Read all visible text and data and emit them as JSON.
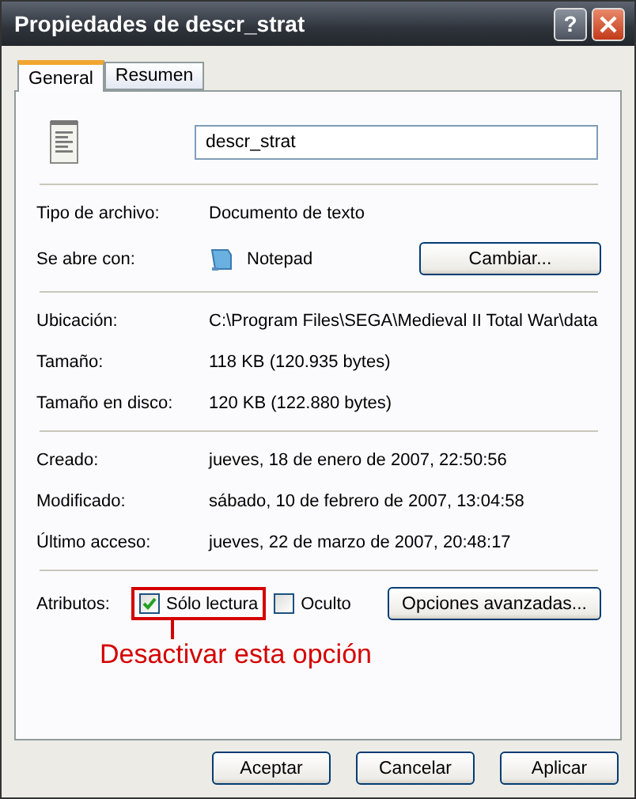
{
  "window": {
    "title": "Propiedades de descr_strat",
    "help_button": "?"
  },
  "tabs": [
    {
      "label": "General",
      "selected": true
    },
    {
      "label": "Resumen",
      "selected": false
    }
  ],
  "file": {
    "name": "descr_strat"
  },
  "sections": [
    {
      "rows": [
        {
          "label": "Tipo de archivo:",
          "value": "Documento de texto"
        },
        {
          "label": "Se abre con:",
          "value": "Notepad",
          "icon": true,
          "button": "Cambiar..."
        }
      ]
    },
    {
      "rows": [
        {
          "label": "Ubicación:",
          "value": "C:\\Program Files\\SEGA\\Medieval II Total War\\data"
        },
        {
          "label": "Tamaño:",
          "value": "118 KB (120.935 bytes)"
        },
        {
          "label": "Tamaño en disco:",
          "value": "120 KB (122.880 bytes)"
        }
      ]
    },
    {
      "rows": [
        {
          "label": "Creado:",
          "value": "jueves, 18 de enero de 2007, 22:50:56"
        },
        {
          "label": "Modificado:",
          "value": "sábado, 10 de febrero de 2007, 13:04:58"
        },
        {
          "label": "Último acceso:",
          "value": "jueves, 22 de marzo de 2007, 20:48:17"
        }
      ]
    }
  ],
  "attributes": {
    "label": "Atributos:",
    "checkboxes": [
      {
        "label": "Sólo lectura",
        "checked": true,
        "highlighted": true
      },
      {
        "label": "Oculto",
        "checked": false,
        "highlighted": false
      }
    ],
    "button": "Opciones avanzadas..."
  },
  "annotation": {
    "text": "Desactivar esta opción"
  },
  "buttons": [
    "Aceptar",
    "Cancelar",
    "Aplicar"
  ]
}
